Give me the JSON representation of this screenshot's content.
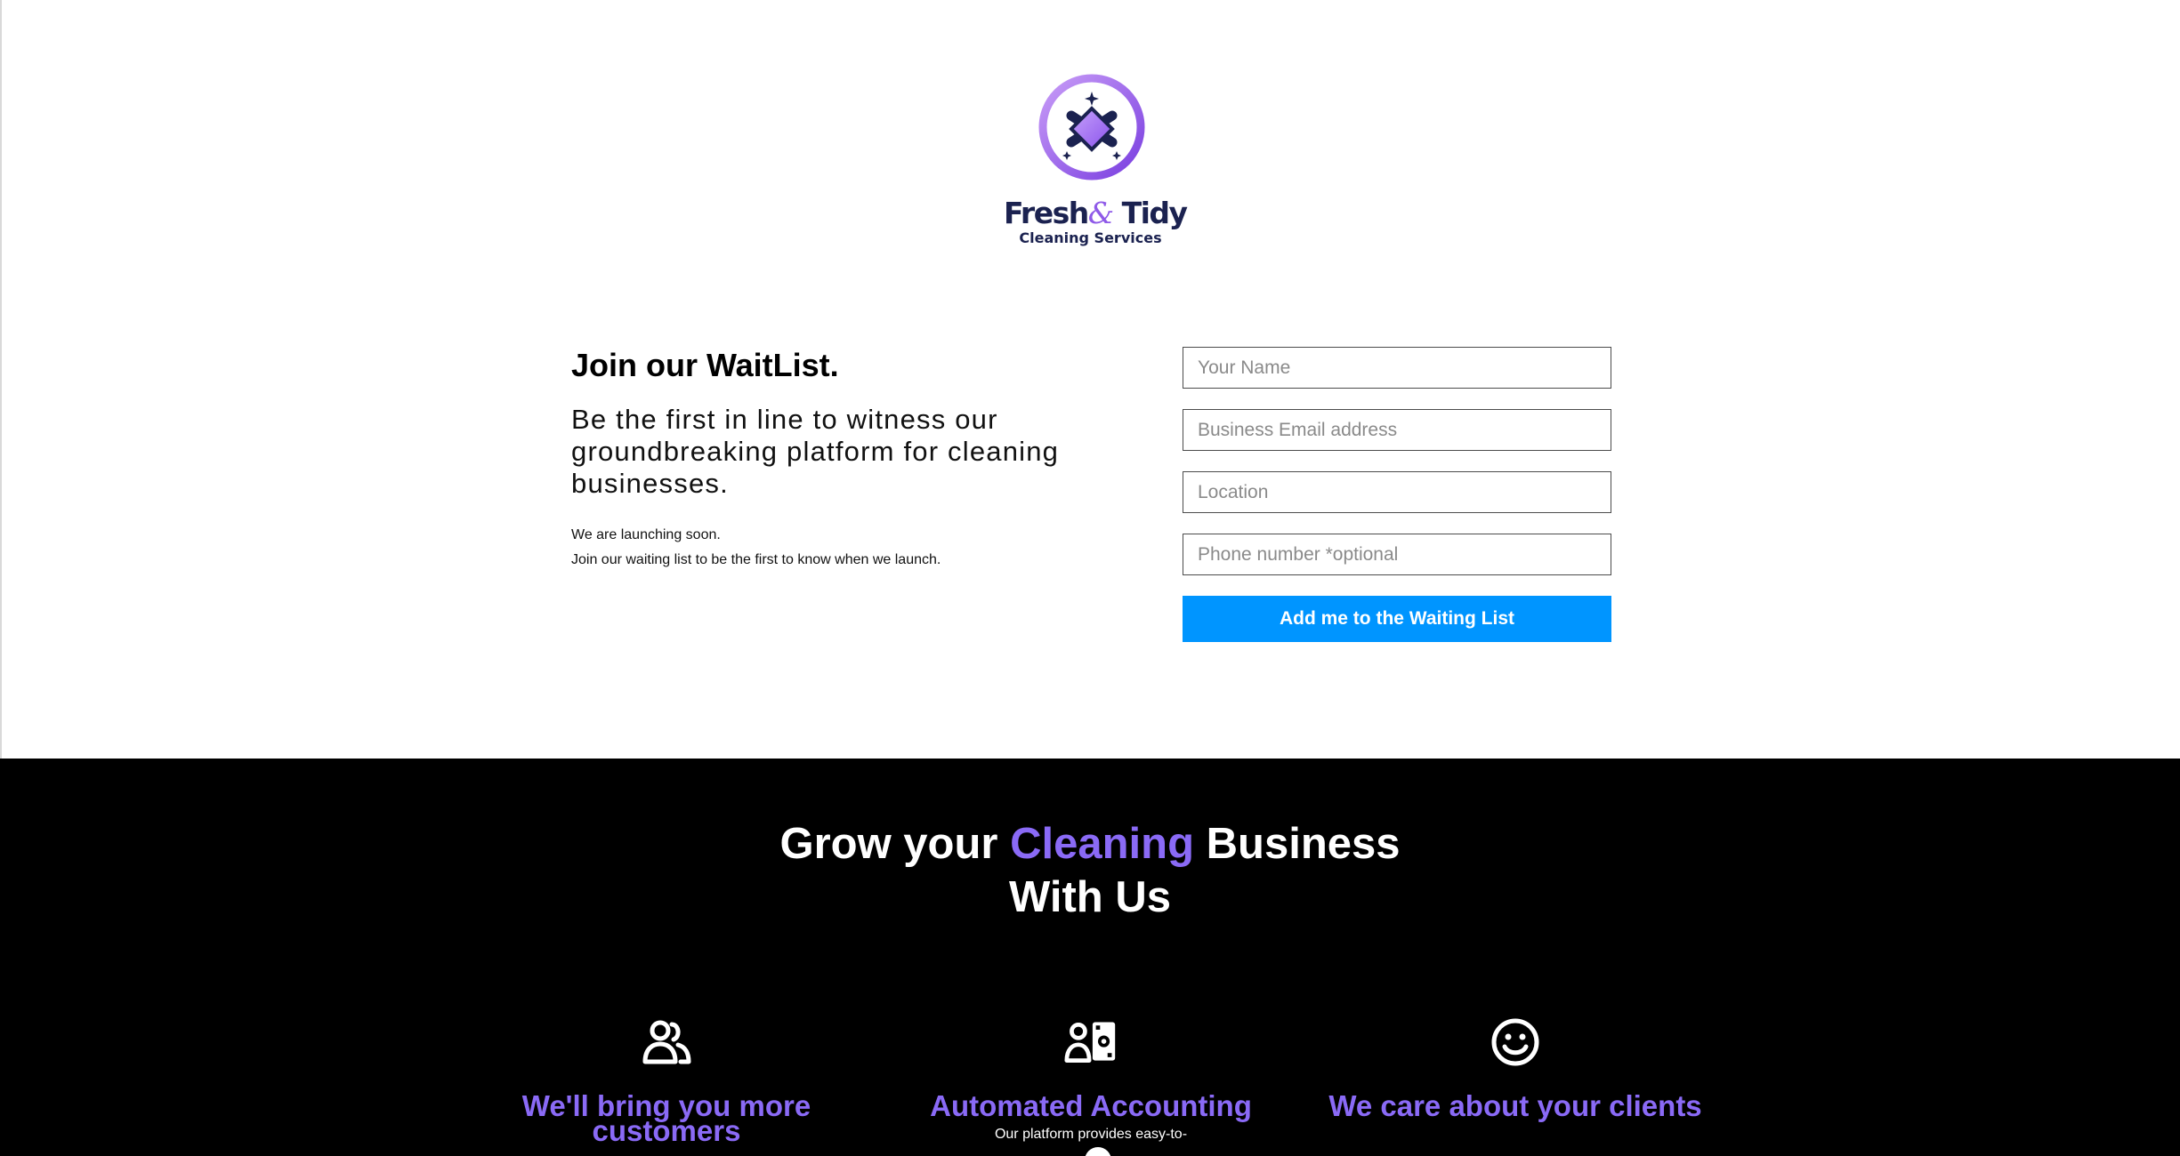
{
  "brand": {
    "name_part1": "Fresh",
    "name_amp": "&",
    "name_part2": "Tidy",
    "subtitle": "Cleaning Services",
    "logo_icon": "sparkle-cleaning-emblem",
    "colors": {
      "navy": "#1b2250",
      "purple": "#8f5ae8"
    }
  },
  "waitlist": {
    "title": "Join our WaitList.",
    "lead": "Be the first in line to witness our groundbreaking platform for cleaning businesses.",
    "line1": "We are launching soon.",
    "line2": "Join our waiting list to be the first to know when we launch."
  },
  "form": {
    "name_placeholder": "Your Name",
    "email_placeholder": "Business Email address",
    "location_placeholder": "Location",
    "phone_placeholder": "Phone number *optional",
    "submit_label": "Add me to the Waiting List",
    "button_color": "#0095ff"
  },
  "grow": {
    "title_start": "Grow your ",
    "title_accent": "Cleaning",
    "title_end": " Business",
    "title_line2": "With Us",
    "accent_color": "#8a6af6"
  },
  "features": [
    {
      "icon": "users-icon",
      "title": "We'll bring you more customers",
      "text": ""
    },
    {
      "icon": "accounting-icon",
      "title": "Automated Accounting",
      "text": "Our platform provides easy-to-"
    },
    {
      "icon": "smiley-icon",
      "title": "We care about your clients",
      "text": ""
    }
  ]
}
